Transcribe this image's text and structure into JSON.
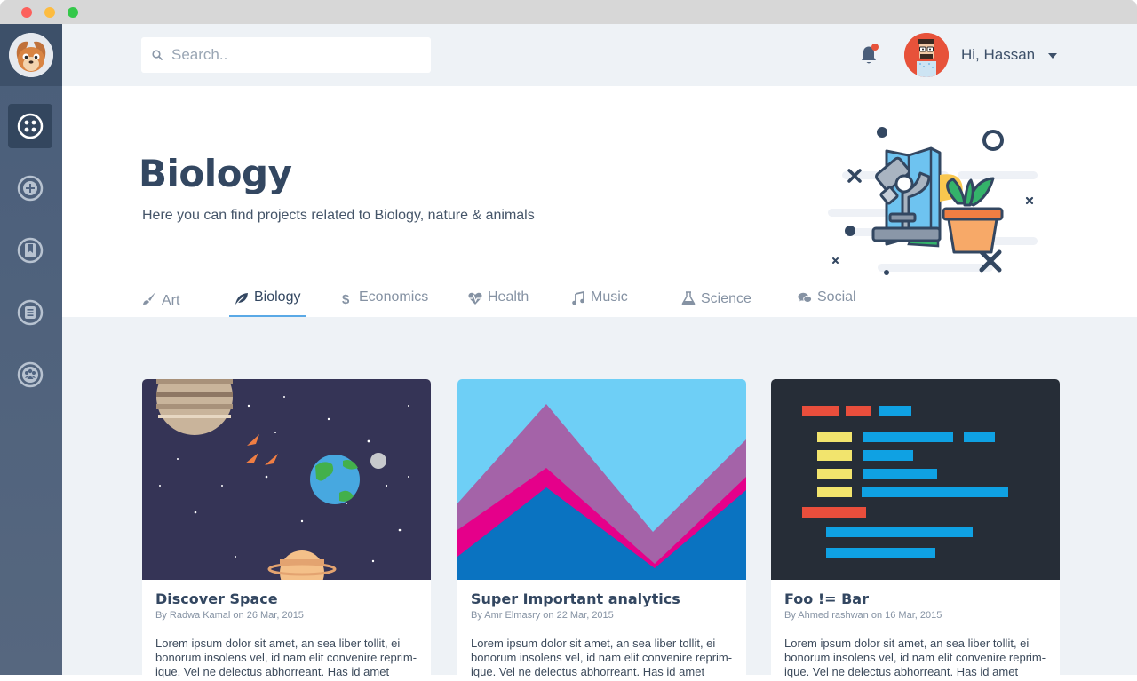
{
  "window": {},
  "sidebar": {
    "logo_name": "squirrel-logo",
    "items": [
      {
        "icon": "dashboard-icon",
        "active": true
      },
      {
        "icon": "add-icon",
        "active": false
      },
      {
        "icon": "bookmark-icon",
        "active": false
      },
      {
        "icon": "document-icon",
        "active": false
      },
      {
        "icon": "users-icon",
        "active": false
      }
    ]
  },
  "header": {
    "search_placeholder": "Search..",
    "greeting": "Hi, Hassan",
    "notification_dot_color": "#e7523a"
  },
  "hero": {
    "title": "Biology",
    "subtitle": "Here you can find projects related to Biology, nature & animals"
  },
  "tabs": [
    {
      "label": "Art",
      "icon": "brush-icon"
    },
    {
      "label": "Biology",
      "icon": "leaf-icon",
      "active": true
    },
    {
      "label": "Economics",
      "icon": "dollar-icon"
    },
    {
      "label": "Health",
      "icon": "heartbeat-icon"
    },
    {
      "label": "Music",
      "icon": "music-icon"
    },
    {
      "label": "Science",
      "icon": "flask-icon"
    },
    {
      "label": "Social",
      "icon": "chat-icon"
    }
  ],
  "cards": [
    {
      "title": "Discover Space",
      "meta": "By Radwa Kamal on 26 Mar, 2015",
      "body": "Lorem ipsum dolor sit amet, an sea liber tollit, ei bonorum insolens vel, id nam elit convenire reprim-ique. Vel ne delectus abhorreant. Has id amet"
    },
    {
      "title": "Super Important analytics",
      "meta": "By Amr Elmasry on 22 Mar, 2015",
      "body": "Lorem ipsum dolor sit amet, an sea liber tollit, ei bonorum insolens vel, id nam elit convenire reprim-ique. Vel ne delectus abhorreant. Has id amet"
    },
    {
      "title": "Foo != Bar",
      "meta": "By Ahmed rashwan on 16 Mar, 2015",
      "body": "Lorem ipsum dolor sit amet, an sea liber tollit, ei bonorum insolens vel, id nam elit convenire reprim-ique. Vel ne delectus abhorreant. Has id amet"
    }
  ],
  "colors": {
    "sidebar": "#4a5e7a",
    "accent": "#5aa9e6",
    "heading": "#334761",
    "content_bg": "#eef2f6"
  }
}
